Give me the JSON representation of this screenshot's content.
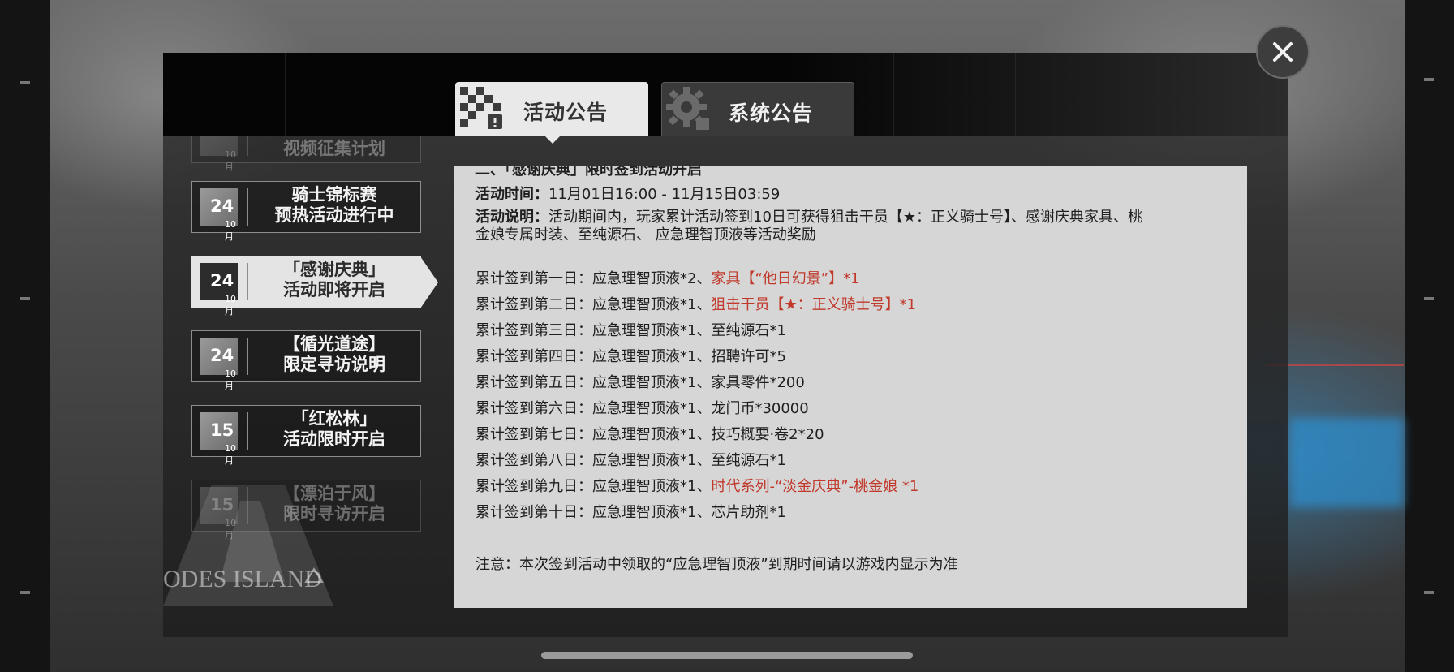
{
  "tabs": [
    {
      "label": "活动公告",
      "active": true,
      "icon": "checkered-flag-icon"
    },
    {
      "label": "系统公告",
      "active": false,
      "icon": "gear-icon"
    }
  ],
  "close_icon": "close-icon",
  "list": [
    {
      "day": "",
      "month": "10月",
      "title_lines": [
        "视频征集计划"
      ],
      "state": "faded"
    },
    {
      "day": "24",
      "month": "10月",
      "title_lines": [
        "骑士锦标赛",
        "预热活动进行中"
      ],
      "state": "normal"
    },
    {
      "day": "24",
      "month": "10月",
      "title_lines": [
        "「感谢庆典」",
        "活动即将开启"
      ],
      "state": "selected"
    },
    {
      "day": "24",
      "month": "10月",
      "title_lines": [
        "【循光道途】",
        "限定寻访说明"
      ],
      "state": "normal"
    },
    {
      "day": "15",
      "month": "10月",
      "title_lines": [
        "「红松林」",
        "活动限时开启"
      ],
      "state": "normal"
    },
    {
      "day": "15",
      "month": "10月",
      "title_lines": [
        "【漂泊于风】",
        "限时寻访开启"
      ],
      "state": "faded"
    }
  ],
  "watermark": "ODES ISLAND",
  "content": {
    "heading": "二、「感谢庆典」限时签到活动开启",
    "time_label": "活动时间：",
    "time_value": "11月01日16:00 - 11月15日03:59",
    "desc_label": "活动说明：",
    "desc_line1": "活动期间内，玩家累计活动签到10日可获得狙击干员【★：正义骑士号】、感谢庆典家具、桃",
    "desc_line2": "金娘专属时装、至纯源石、 应急理智顶液等活动奖励",
    "rewards": [
      {
        "prefix": "累计签到第一日：应急理智顶液*2、",
        "highlight": "家具【“他日幻景”】*1"
      },
      {
        "prefix": "累计签到第二日：应急理智顶液*1、",
        "highlight": "狙击干员【★：正义骑士号】*1"
      },
      {
        "prefix": "累计签到第三日：应急理智顶液*1、至纯源石*1",
        "highlight": ""
      },
      {
        "prefix": "累计签到第四日：应急理智顶液*1、招聘许可*5",
        "highlight": ""
      },
      {
        "prefix": "累计签到第五日：应急理智顶液*1、家具零件*200",
        "highlight": ""
      },
      {
        "prefix": "累计签到第六日：应急理智顶液*1、龙门币*30000",
        "highlight": ""
      },
      {
        "prefix": "累计签到第七日：应急理智顶液*1、技巧概要·卷2*20",
        "highlight": ""
      },
      {
        "prefix": "累计签到第八日：应急理智顶液*1、至纯源石*1",
        "highlight": ""
      },
      {
        "prefix": "累计签到第九日：应急理智顶液*1、",
        "highlight": "时代系列-“淡金庆典”-桃金娘 *1"
      },
      {
        "prefix": "累计签到第十日：应急理智顶液*1、芯片助剂*1",
        "highlight": ""
      }
    ],
    "note": "注意：本次签到活动中领取的“应急理智顶液”到期时间请以游戏内显示为准"
  }
}
